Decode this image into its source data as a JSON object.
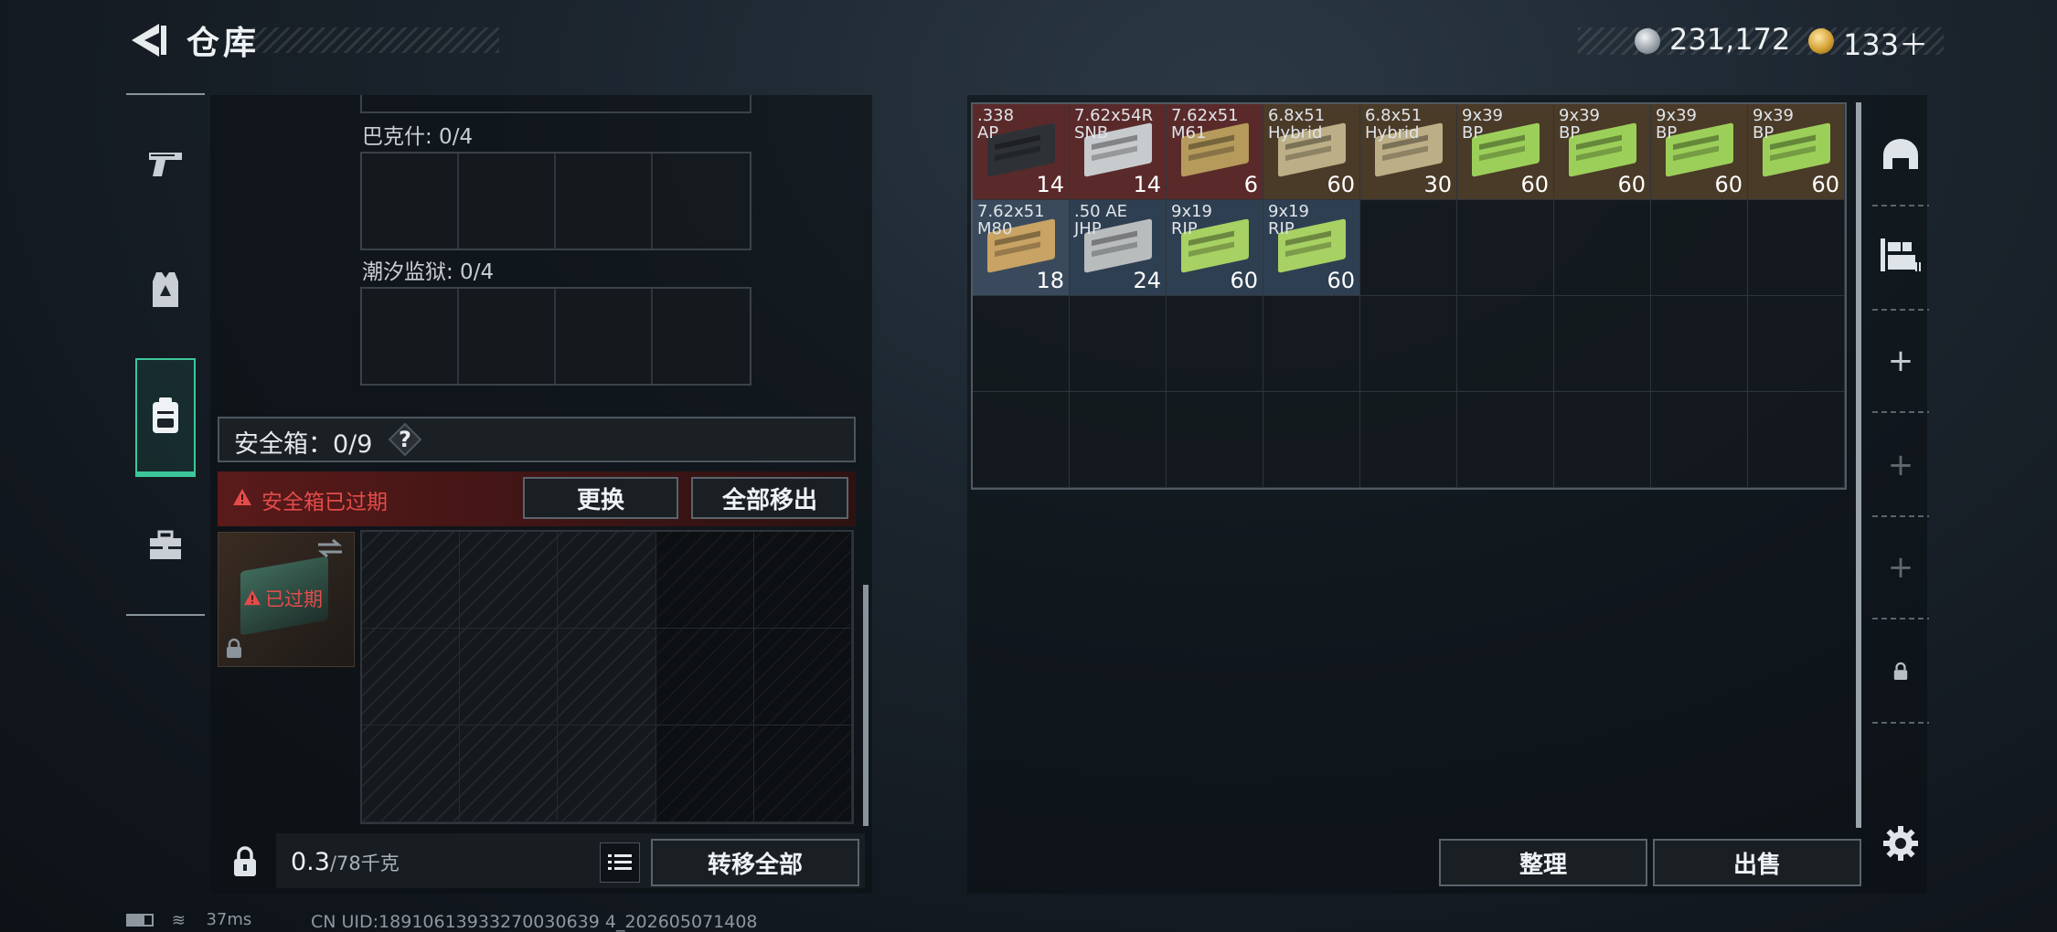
{
  "header": {
    "title": "仓库",
    "silver_amount": "231,172",
    "gold_amount": "133＋"
  },
  "left_nav": {
    "items": [
      {
        "icon": "pistol-icon"
      },
      {
        "icon": "armor-vest-icon"
      },
      {
        "icon": "backpack-icon",
        "active": true
      },
      {
        "icon": "toolbox-icon"
      }
    ]
  },
  "loadout": {
    "groups": [
      {
        "label": "巴克什: 0/4"
      },
      {
        "label": "潮汐监狱: 0/4"
      }
    ],
    "safebox": {
      "label": "安全箱：0/9",
      "help": "?",
      "expired_warning": "安全箱已过期",
      "replace_label": "更换",
      "move_all_out_label": "全部移出",
      "case_status": "已过期"
    },
    "weight_value": "0.3",
    "weight_capacity": "/78千克",
    "transfer_all_label": "转移全部"
  },
  "stash": {
    "items": [
      {
        "name": ".338\nAP",
        "qty": "14",
        "bg": "#5a2a2a",
        "pic": "#2e3236"
      },
      {
        "name": "7.62x54R\nSNB",
        "qty": "14",
        "bg": "#5a2a2a",
        "pic": "#c8cbcd"
      },
      {
        "name": "7.62x51\nM61",
        "qty": "6",
        "bg": "#5a2a2a",
        "pic": "#b59a5c"
      },
      {
        "name": "6.8x51\nHybrid",
        "qty": "60",
        "bg": "#4a3a28",
        "pic": "#bcae86"
      },
      {
        "name": "6.8x51\nHybrid",
        "qty": "30",
        "bg": "#4a3a28",
        "pic": "#bcae86"
      },
      {
        "name": "9x39\nBP",
        "qty": "60",
        "bg": "#4a3a28",
        "pic": "#9ccf5a"
      },
      {
        "name": "9x39\nBP",
        "qty": "60",
        "bg": "#4a3a28",
        "pic": "#9ccf5a"
      },
      {
        "name": "9x39\nBP",
        "qty": "60",
        "bg": "#4a3a28",
        "pic": "#9ccf5a"
      },
      {
        "name": "9x39\nBP",
        "qty": "60",
        "bg": "#4a3a28",
        "pic": "#9ccf5a"
      },
      {
        "name": "7.62x51\nM80",
        "qty": "18",
        "bg": "#3a4a5c",
        "pic": "#c8a364"
      },
      {
        "name": ".50 AE\nJHP",
        "qty": "24",
        "bg": "#2f3f52",
        "pic": "#b9bcbd"
      },
      {
        "name": "9x19\nRIP",
        "qty": "60",
        "bg": "#2f3f52",
        "pic": "#a7d163"
      },
      {
        "name": "9x19\nRIP",
        "qty": "60",
        "bg": "#2f3f52",
        "pic": "#a7d163"
      }
    ],
    "sort_label": "整理",
    "sell_label": "出售"
  },
  "right_sidebar": {
    "icons": [
      "helmet-icon",
      "storage-shelf-icon"
    ],
    "add_slots": [
      "+",
      "+",
      "+"
    ]
  },
  "status_bar": {
    "ping": "37ms",
    "uid": "CN UID:18910613933270030639 4_202605071408"
  }
}
